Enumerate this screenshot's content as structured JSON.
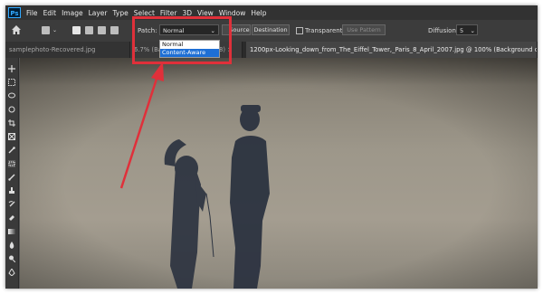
{
  "app": {
    "logo_text": "Ps"
  },
  "menu": [
    "File",
    "Edit",
    "Image",
    "Layer",
    "Type",
    "Select",
    "Filter",
    "3D",
    "View",
    "Window",
    "Help"
  ],
  "options_bar": {
    "patch_label": "Patch:",
    "patch_value": "Normal",
    "source_label": "Source",
    "destination_label": "Destination",
    "transparent_label": "Transparent",
    "use_pattern_label": "Use Pattern",
    "diffusion_label": "Diffusion:",
    "diffusion_value": "5"
  },
  "dropdown": {
    "options": [
      "Normal",
      "Content-Aware"
    ],
    "selected": "Content-Aware"
  },
  "tabs": [
    {
      "label": "samplephoto-Recovered.jpg",
      "active": false
    },
    {
      "label": "6.7% (Ba",
      "active": false
    },
    {
      "label": "8)",
      "active": false
    },
    {
      "label": "1200px-Looking_down_from_The_Eiffel_Tower,_Paris_8_April_2007.jpg @ 100% (Background copy, RGB",
      "active": true
    }
  ],
  "tab_close_glyph": "×",
  "tools": [
    "move-icon",
    "marquee-icon",
    "lasso-icon",
    "quick-select-icon",
    "crop-icon",
    "frame-icon",
    "eyedropper-icon",
    "patch-icon",
    "brush-icon",
    "stamp-icon",
    "history-brush-icon",
    "eraser-icon",
    "gradient-icon",
    "blur-icon",
    "dodge-icon",
    "pen-icon"
  ],
  "colors": {
    "highlight": "#e0303a",
    "selection": "#1e6fd6",
    "ui_dark": "#323232"
  }
}
